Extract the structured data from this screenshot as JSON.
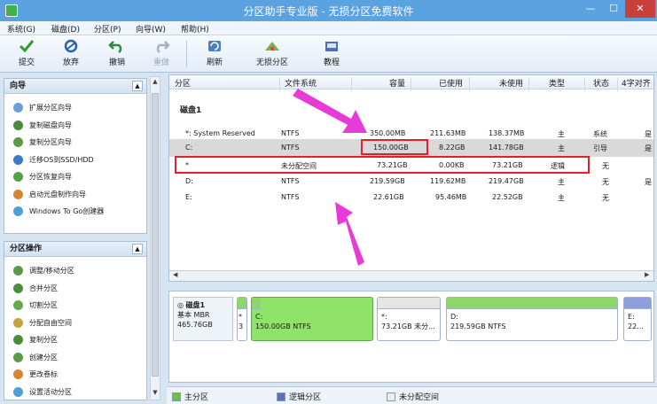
{
  "window": {
    "title": "分区助手专业版 - 无损分区免费软件",
    "minimize": "—",
    "maximize": "☐",
    "close": "✕"
  },
  "menu": [
    "系统(G)",
    "磁盘(D)",
    "分区(P)",
    "向导(W)",
    "帮助(H)"
  ],
  "toolbar": {
    "buttons": [
      {
        "label": "提交",
        "icon": "check-icon",
        "enabled": true
      },
      {
        "label": "放弃",
        "icon": "discard-icon",
        "enabled": true
      },
      {
        "label": "撤销",
        "icon": "undo-icon",
        "enabled": true
      },
      {
        "label": "重做",
        "icon": "redo-icon",
        "enabled": false
      },
      {
        "label": "刷新",
        "icon": "refresh-icon",
        "enabled": true
      },
      {
        "label": "无损分区",
        "icon": "partition-icon",
        "enabled": true
      },
      {
        "label": "教程",
        "icon": "tutorial-icon",
        "enabled": true
      }
    ]
  },
  "wizard_panel": {
    "title": "向导",
    "items": [
      "扩展分区向导",
      "复制磁盘向导",
      "复制分区向导",
      "迁移OS到SSD/HDD",
      "分区恢复向导",
      "启动光盘制作向导",
      "Windows To Go创建器"
    ]
  },
  "ops_panel": {
    "title": "分区操作",
    "items": [
      "调整/移动分区",
      "合并分区",
      "切割分区",
      "分配自由空间",
      "复制分区",
      "创建分区",
      "更改卷标",
      "设置活动分区"
    ]
  },
  "table": {
    "columns": [
      "分区",
      "文件系统",
      "容量",
      "已使用",
      "未使用",
      "类型",
      "状态",
      "4字对齐"
    ],
    "disk_label": "磁盘1",
    "rows": [
      {
        "name": "*: System Reserved",
        "fs": "NTFS",
        "capacity": "350.00MB",
        "used": "211.63MB",
        "free": "138.37MB",
        "type": "主",
        "status": "系统",
        "align": "是"
      },
      {
        "name": "C:",
        "fs": "NTFS",
        "capacity": "150.00GB",
        "used": "8.22GB",
        "free": "141.78GB",
        "type": "主",
        "status": "引导",
        "align": "是"
      },
      {
        "name": "*",
        "fs": "未分配空间",
        "capacity": "73.21GB",
        "used": "0.00KB",
        "free": "73.21GB",
        "type": "逻辑",
        "status": "无",
        "align": ""
      },
      {
        "name": "D:",
        "fs": "NTFS",
        "capacity": "219.59GB",
        "used": "119.62MB",
        "free": "219.47GB",
        "type": "主",
        "status": "无",
        "align": "是"
      },
      {
        "name": "E:",
        "fs": "NTFS",
        "capacity": "22.61GB",
        "used": "95.46MB",
        "free": "22.52GB",
        "type": "主",
        "status": "无",
        "align": ""
      }
    ]
  },
  "disk_map": {
    "disk_name": "磁盘1",
    "disk_type": "基本 MBR",
    "disk_size": "465.76GB",
    "partitions": [
      {
        "label": "*",
        "detail": "3",
        "kind": "primary"
      },
      {
        "label": "C:",
        "detail": "150.00GB NTFS",
        "kind": "primary-selected"
      },
      {
        "label": "*:",
        "detail": "73.21GB 未分...",
        "kind": "unallocated"
      },
      {
        "label": "D:",
        "detail": "219.59GB NTFS",
        "kind": "primary"
      },
      {
        "label": "E:",
        "detail": "22...",
        "kind": "logical"
      }
    ]
  },
  "legend": [
    {
      "label": "主分区",
      "color": "#6cc04a"
    },
    {
      "label": "逻辑分区",
      "color": "#5a6fc8"
    },
    {
      "label": "未分配空间",
      "color": "#ececec"
    }
  ],
  "colors": {
    "titlebar": "#5aa2e0",
    "highlight": "#e0202c",
    "arrow": "#e63bd6"
  }
}
